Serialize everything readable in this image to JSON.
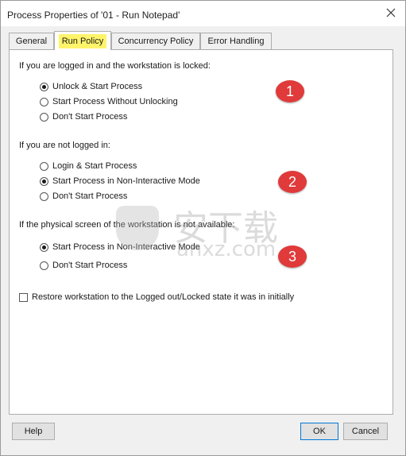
{
  "window": {
    "title": "Process Properties of '01 - Run Notepad'",
    "close_icon": "close-icon"
  },
  "tabs": [
    "General",
    "Run Policy",
    "Concurrency Policy",
    "Error Handling"
  ],
  "active_tab": "Run Policy",
  "highlight_color": "#fff46a",
  "groups": [
    {
      "label": "If you are logged in and the workstation is locked:",
      "options": [
        "Unlock & Start Process",
        "Start Process Without Unlocking",
        "Don't Start Process"
      ],
      "selected": "Unlock & Start Process",
      "badge": "1"
    },
    {
      "label": "If you are not logged in:",
      "options": [
        "Login & Start Process",
        "Start Process in Non-Interactive Mode",
        "Don't Start Process"
      ],
      "selected": "Start Process in Non-Interactive Mode",
      "badge": "2"
    },
    {
      "label": "If the physical screen of the workstation is not available:",
      "options": [
        "Start Process in Non-Interactive Mode",
        "Don't Start Process"
      ],
      "selected": "Start Process in Non-Interactive Mode",
      "badge": "3"
    }
  ],
  "restore_checkbox": {
    "label": "Restore workstation to the Logged out/Locked state it was in initially",
    "checked": false
  },
  "badge_color": "#e03a3a",
  "watermark": {
    "cn": "安下载",
    "en": "anxz.com"
  },
  "buttons": {
    "help": "Help",
    "ok": "OK",
    "cancel": "Cancel"
  }
}
